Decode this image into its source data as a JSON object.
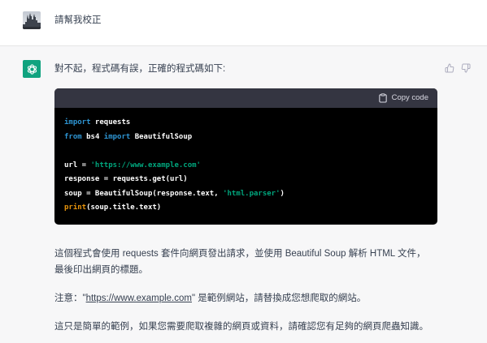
{
  "colors": {
    "text": "#374151",
    "assistant_bg": "#f7f7f8",
    "avatar_green": "#10a37f",
    "code_header": "#343541",
    "code_bg": "#000000",
    "muted_icon": "#acacbe"
  },
  "icons": {
    "user_avatar": "user-photo-avatar",
    "assistant_avatar": "chatgpt-logo-icon",
    "copy": "clipboard-icon",
    "like": "thumbs-up-icon",
    "dislike": "thumbs-down-icon"
  },
  "user": {
    "message": "請幫我校正"
  },
  "assistant": {
    "intro": "對不起，程式碼有誤，正確的程式碼如下:",
    "code_block": {
      "copy_label": "Copy code",
      "lines": [
        [
          {
            "text": "import",
            "color": "#2e95d3"
          },
          {
            "text": " requests",
            "color": "#ffffff"
          }
        ],
        [
          {
            "text": "from",
            "color": "#2e95d3"
          },
          {
            "text": " bs4 ",
            "color": "#ffffff"
          },
          {
            "text": "import",
            "color": "#2e95d3"
          },
          {
            "text": " BeautifulSoup",
            "color": "#ffffff"
          }
        ],
        [],
        [
          {
            "text": "url = ",
            "color": "#ffffff"
          },
          {
            "text": "'https://www.example.com'",
            "color": "#00a67d"
          }
        ],
        [
          {
            "text": "response = requests.get(url)",
            "color": "#ffffff"
          }
        ],
        [
          {
            "text": "soup = BeautifulSoup(response.text, ",
            "color": "#ffffff"
          },
          {
            "text": "'html.parser'",
            "color": "#00a67d"
          },
          {
            "text": ")",
            "color": "#ffffff"
          }
        ],
        [
          {
            "text": "print",
            "color": "#e9950c"
          },
          {
            "text": "(soup.title.text)",
            "color": "#ffffff"
          }
        ]
      ]
    },
    "explanation_lines": [
      "這個程式會使用 requests 套件向網頁發出請求，並使用 Beautiful Soup 解析 HTML 文件，",
      "最後印出網頁的標題。"
    ],
    "note": {
      "prefix": "注意：\"",
      "link": "https://www.example.com",
      "suffix": "\" 是範例網站，請替換成您想爬取的網站。"
    },
    "disclaimer": "這只是簡單的範例，如果您需要爬取複雜的網頁或資料，請確認您有足夠的網頁爬蟲知識。"
  }
}
